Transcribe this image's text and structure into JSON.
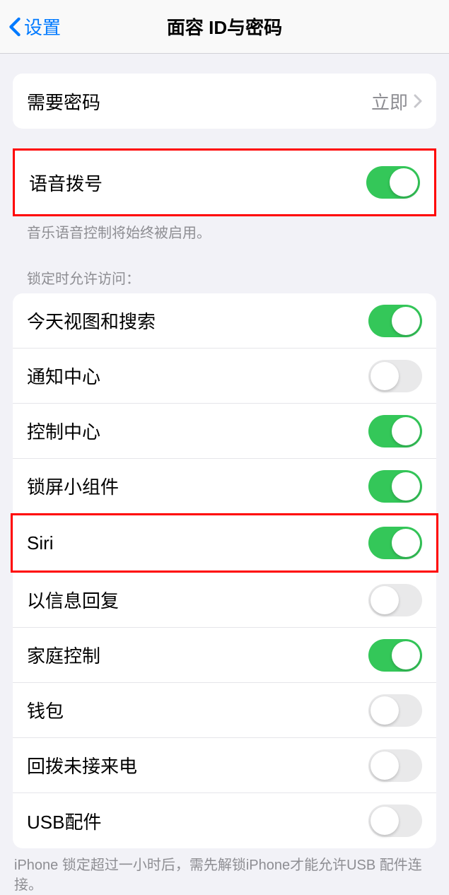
{
  "header": {
    "back_label": "设置",
    "title": "面容 ID与密码"
  },
  "passcode": {
    "label": "需要密码",
    "value": "立即"
  },
  "voice_dial": {
    "label": "语音拨号",
    "enabled": true,
    "footer": "音乐语音控制将始终被启用。"
  },
  "locked_access": {
    "header": "锁定时允许访问：",
    "items": [
      {
        "label": "今天视图和搜索",
        "enabled": true
      },
      {
        "label": "通知中心",
        "enabled": false
      },
      {
        "label": "控制中心",
        "enabled": true
      },
      {
        "label": "锁屏小组件",
        "enabled": true
      },
      {
        "label": "Siri",
        "enabled": true
      },
      {
        "label": "以信息回复",
        "enabled": false
      },
      {
        "label": "家庭控制",
        "enabled": true
      },
      {
        "label": "钱包",
        "enabled": false
      },
      {
        "label": "回拨未接来电",
        "enabled": false
      },
      {
        "label": "USB配件",
        "enabled": false
      }
    ],
    "footer": "iPhone 锁定超过一小时后，需先解锁iPhone才能允许USB 配件连接。"
  }
}
